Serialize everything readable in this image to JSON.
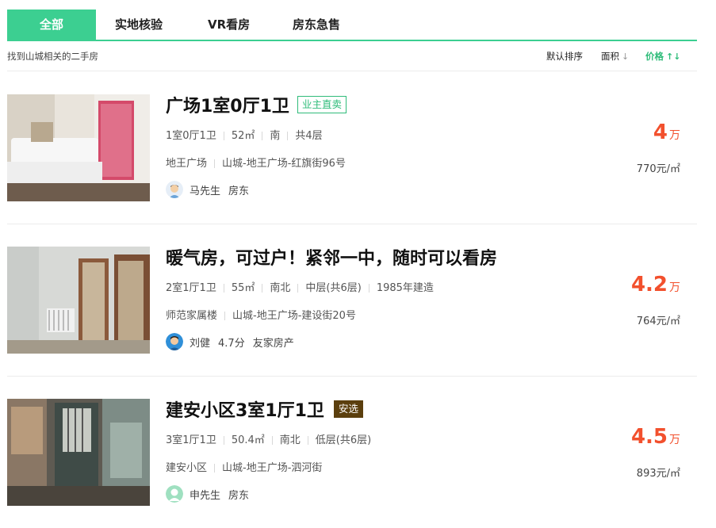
{
  "tabs": [
    {
      "label": "全部",
      "active": true
    },
    {
      "label": "实地核验",
      "active": false
    },
    {
      "label": "VR看房",
      "active": false
    },
    {
      "label": "房东急售",
      "active": false
    }
  ],
  "found_text": "找到山城相关的二手房",
  "sort": {
    "default": "默认排序",
    "area": "面积",
    "price": "价格",
    "area_arrow": "↓",
    "price_arrow": "↑↓"
  },
  "colors": {
    "accent": "#3ccf91",
    "price": "#f2502d",
    "anxuan_bg": "#5b3f0e"
  },
  "listings": [
    {
      "title": "广场1室0厅1卫",
      "tag": "业主直卖",
      "tag_type": "owner",
      "layout": "1室0厅1卫",
      "area": "52㎡",
      "orientation": "南",
      "floor": "共4层",
      "community": "地王广场",
      "address": "山城-地王广场-红旗街96号",
      "agent_name": "马先生",
      "agent_role": "房东",
      "agent_score": "",
      "price": "4",
      "price_unit": "万",
      "unit_price": "770元/㎡"
    },
    {
      "title": "暖气房，可过户！紧邻一中，随时可以看房",
      "layout": "2室1厅1卫",
      "area": "55㎡",
      "orientation": "南北",
      "floor": "中层(共6层)",
      "year": "1985年建造",
      "community": "师范家属楼",
      "address": "山城-地王广场-建设街20号",
      "agent_name": "刘健",
      "agent_score": "4.7分",
      "agent_role": "友家房产",
      "price": "4.2",
      "price_unit": "万",
      "unit_price": "764元/㎡"
    },
    {
      "title": "建安小区3室1厅1卫",
      "tag": "安选",
      "tag_type": "anxuan",
      "layout": "3室1厅1卫",
      "area": "50.4㎡",
      "orientation": "南北",
      "floor": "低层(共6层)",
      "community": "建安小区",
      "address": "山城-地王广场-泗河街",
      "agent_name": "申先生",
      "agent_role": "房东",
      "price": "4.5",
      "price_unit": "万",
      "unit_price": "893元/㎡"
    }
  ]
}
